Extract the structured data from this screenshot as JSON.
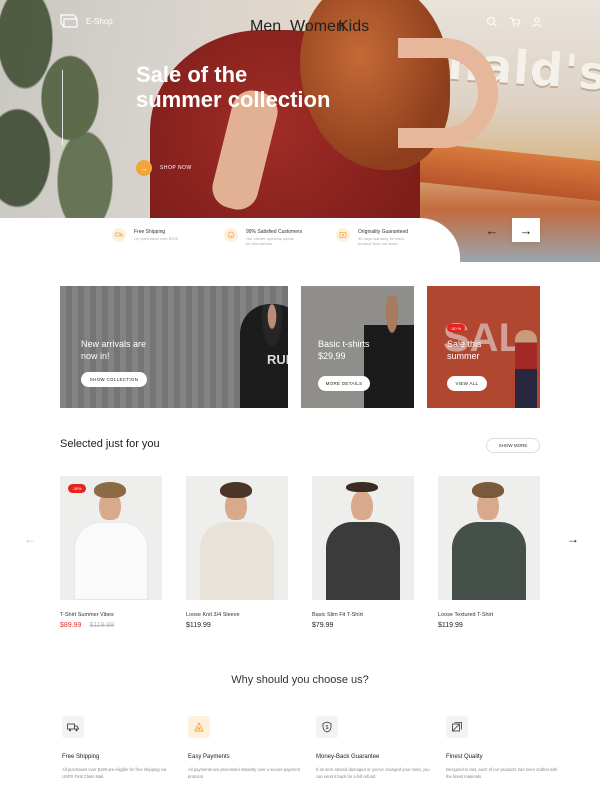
{
  "header": {
    "brand": "E-Shop",
    "nav": [
      "Men",
      "Women",
      "Kids"
    ]
  },
  "hero": {
    "title": "Sale of the summer collection",
    "cta": "SHOP NOW",
    "features": [
      {
        "title": "Free Shipping",
        "desc": "On purchases over $199",
        "icon": "truck-icon"
      },
      {
        "title": "99% Satisfied Customers",
        "desc": "Our clients' opinions speak for themselves",
        "icon": "smile-icon"
      },
      {
        "title": "Originality Guaranteed",
        "desc": "30 days warranty for each product from our store",
        "icon": "certificate-icon"
      }
    ]
  },
  "promos": [
    {
      "title": "New arrivals are now in!",
      "button": "SHOW COLLECTION"
    },
    {
      "title": "Basic t-shirts $29,99",
      "button": "MORE DETAILS"
    },
    {
      "title": "Sale this summer",
      "button": "VIEW ALL",
      "badge": "-50 %",
      "bg_text": "SAL"
    }
  ],
  "print_text": "RUN",
  "selected": {
    "title": "Selected just for you",
    "show_more": "SHOW MORE",
    "products": [
      {
        "name": "T-Shirt Summer Vibes",
        "price": "$89.99",
        "old_price": "$119.99",
        "badge": "-30%"
      },
      {
        "name": "Loose Knit 3/4 Sleeve",
        "price": "$119.99"
      },
      {
        "name": "Basic Slim Fit T-Shirt",
        "price": "$79.99"
      },
      {
        "name": "Loose Textured T-Shirt",
        "price": "$119.99"
      }
    ]
  },
  "why": {
    "title": "Why should you choose us?",
    "items": [
      {
        "title": "Free Shipping",
        "desc": "All purchases over $199 are eligible for free shipping via USPS First Class Mail.",
        "icon": "truck-icon"
      },
      {
        "title": "Easy Payments",
        "desc": "All payments are processed instantly over a secure payment protocol.",
        "icon": "payment-icon"
      },
      {
        "title": "Money-Back Guarantee",
        "desc": "If an item arrived damaged or you've changed your mind, you can send it back for a full refund.",
        "icon": "money-back-icon"
      },
      {
        "title": "Finest Quality",
        "desc": "Designed to last, each of our products has been crafted with the finest materials.",
        "icon": "quality-icon"
      }
    ]
  },
  "colors": {
    "accent": "#f0a63a",
    "sale": "#e2312a",
    "hero_shirt": "#8e2520"
  }
}
